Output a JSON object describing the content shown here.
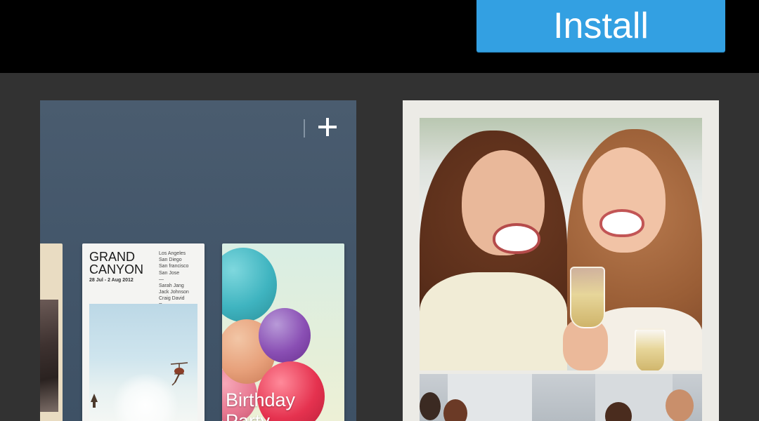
{
  "header": {
    "install_label": "Install"
  },
  "screenshots": [
    {
      "kind": "app-albums-view",
      "cards": [
        {
          "title": "GRAND\nCANYON",
          "date": "28 Jul - 2 Aug 2012",
          "people": "Los Angeles\nSan Diego\nSan francisco\nSan Jose\n—\nSarah Jang\nJack Johnson\nCraig David\nRoven"
        },
        {
          "title": "Birthday\nParty"
        }
      ]
    },
    {
      "kind": "photo-collage"
    }
  ],
  "colors": {
    "install": "#33a0e2",
    "background": "#323232",
    "topbar": "#000000"
  }
}
